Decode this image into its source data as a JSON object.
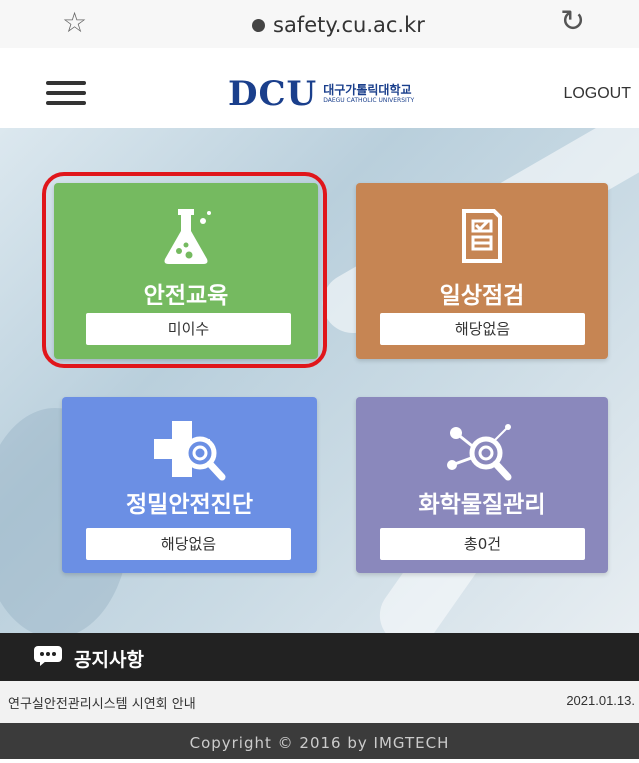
{
  "browser": {
    "url": "safety.cu.ac.kr"
  },
  "header": {
    "logo_mark": "DCU",
    "logo_korean": "대구가톨릭대학교",
    "logo_english": "DAEGU CATHOLIC UNIVERSITY",
    "logout_label": "LOGOUT"
  },
  "tiles": [
    {
      "label": "안전교육",
      "status": "미이수",
      "color": "#75ba60",
      "icon": "flask-icon",
      "highlighted": true
    },
    {
      "label": "일상점검",
      "status": "해당없음",
      "color": "#c68553",
      "icon": "checklist-icon",
      "highlighted": false
    },
    {
      "label": "정밀안전진단",
      "status": "해당없음",
      "color": "#6b8fe4",
      "icon": "cross-magnifier-icon",
      "highlighted": false
    },
    {
      "label": "화학물질관리",
      "status": "총0건",
      "color": "#8a88bc",
      "icon": "molecule-magnifier-icon",
      "highlighted": false
    }
  ],
  "notice": {
    "title": "공지사항",
    "items": [
      {
        "text": "연구실안전관리시스템 시연회 안내",
        "date": "2021.01.13."
      }
    ]
  },
  "footer": {
    "copyright": "Copyright © 2016 by IMGTECH"
  },
  "colors": {
    "highlight": "#e0161b",
    "footer_bg": "#3b3b3b",
    "notice_bg": "#222222"
  }
}
